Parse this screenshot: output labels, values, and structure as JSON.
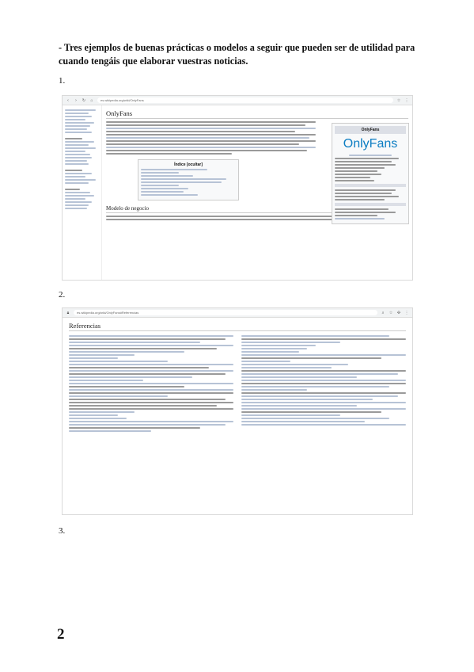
{
  "heading": "- Tres ejemplos de buenas prácticas o modelos a seguir que pueden ser de utilidad para cuando tengáis que elaborar vuestras noticias.",
  "items": [
    {
      "number": "1."
    },
    {
      "number": "2."
    },
    {
      "number": "3."
    }
  ],
  "shot1": {
    "url": "es.wikipedia.org/wiki/OnlyFans",
    "title": "OnlyFans",
    "infobox_title": "OnlyFans",
    "logo_text": "OnlyFans",
    "toc_title": "Índice [ocultar]",
    "section_title": "Modelo de negocio"
  },
  "shot2": {
    "url": "es.wikipedia.org/wiki/OnlyFans#Referencias",
    "title": "Referencias"
  },
  "page_number": "2"
}
